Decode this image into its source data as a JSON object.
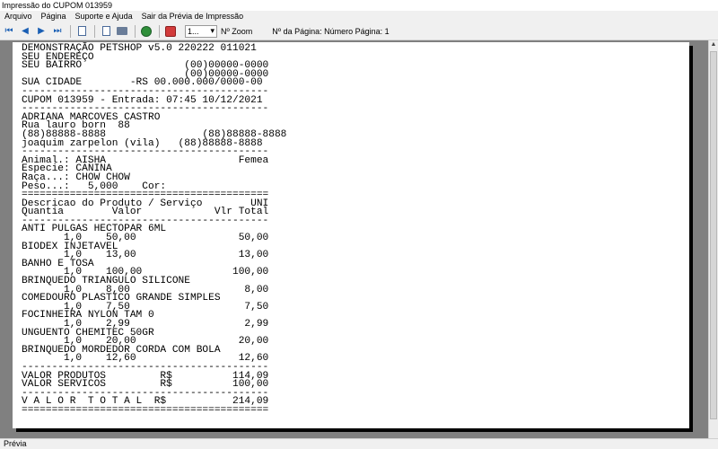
{
  "window": {
    "title": "Impressão do CUPOM 013959"
  },
  "menu": [
    "Arquivo",
    "Página",
    "Suporte e Ajuda",
    "Sair da Prévia de Impressão"
  ],
  "toolbar": {
    "zoom_value": "1...",
    "zoom_label": "Nº Zoom",
    "page_label": "Nº da Página: Número Página: 1",
    "icons": [
      "first-page-icon",
      "prev-page-icon",
      "next-page-icon",
      "last-page-icon",
      "document-icon",
      "print-setup-icon",
      "printer-icon",
      "globe-icon",
      "stop-icon"
    ]
  },
  "receipt_lines": [
    "DEMONSTRAÇÃO PETSHOP v5.0 220222 011021",
    "SEU ENDEREÇO",
    "SEU BAIRRO                 (00)00000-0000",
    "                           (00)00000-0000",
    "SUA CIDADE        -RS 00.000.000/0000-00",
    "-----------------------------------------",
    "CUPOM 013959 - Entrada: 07:45 10/12/2021",
    "-----------------------------------------",
    "ADRIANA MARCOVES CASTRO",
    "Rua lauro born  88",
    "(88)88888-8888                (88)88888-8888",
    "joaquim zarpelon (vila)   (88)88888-8888",
    "-----------------------------------------",
    "Animal.: AISHA                      Femea",
    "Especie: CANINA",
    "Raça...: CHOW CHOW",
    "Peso...:   5,000    Cor:",
    "=========================================",
    "Descricao do Produto / Serviço        UNI",
    "Quantia        Valor            Vlr Total",
    "-----------------------------------------",
    "ANTI PULGAS HECTOPAR 6ML",
    "       1,0    50,00                 50,00",
    "BIODEX INJETAVEL",
    "       1,0    13,00                 13,00",
    "BANHO E TOSA",
    "       1,0    100,00               100,00",
    "BRINQUEDO TRIANGULO SILICONE",
    "       1,0    8,00                   8,00",
    "COMEDOURO PLASTICO GRANDE SIMPLES",
    "       1,0    7,50                   7,50",
    "FOCINHEIRA NYLON TAM 0",
    "       1,0    2,99                   2,99",
    "UNGUENTO CHEMITEC 50GR",
    "       1,0    20,00                 20,00",
    "BRINQUEDO MORDEDOR CORDA COM BOLA",
    "       1,0    12,60                 12,60",
    "-----------------------------------------",
    "VALOR PRODUTOS         R$          114,09",
    "VALOR SERVICOS         R$          100,00",
    "-----------------------------------------",
    "V A L O R  T O T A L  R$           214,09",
    "========================================="
  ],
  "status": {
    "text": "Prévia"
  }
}
